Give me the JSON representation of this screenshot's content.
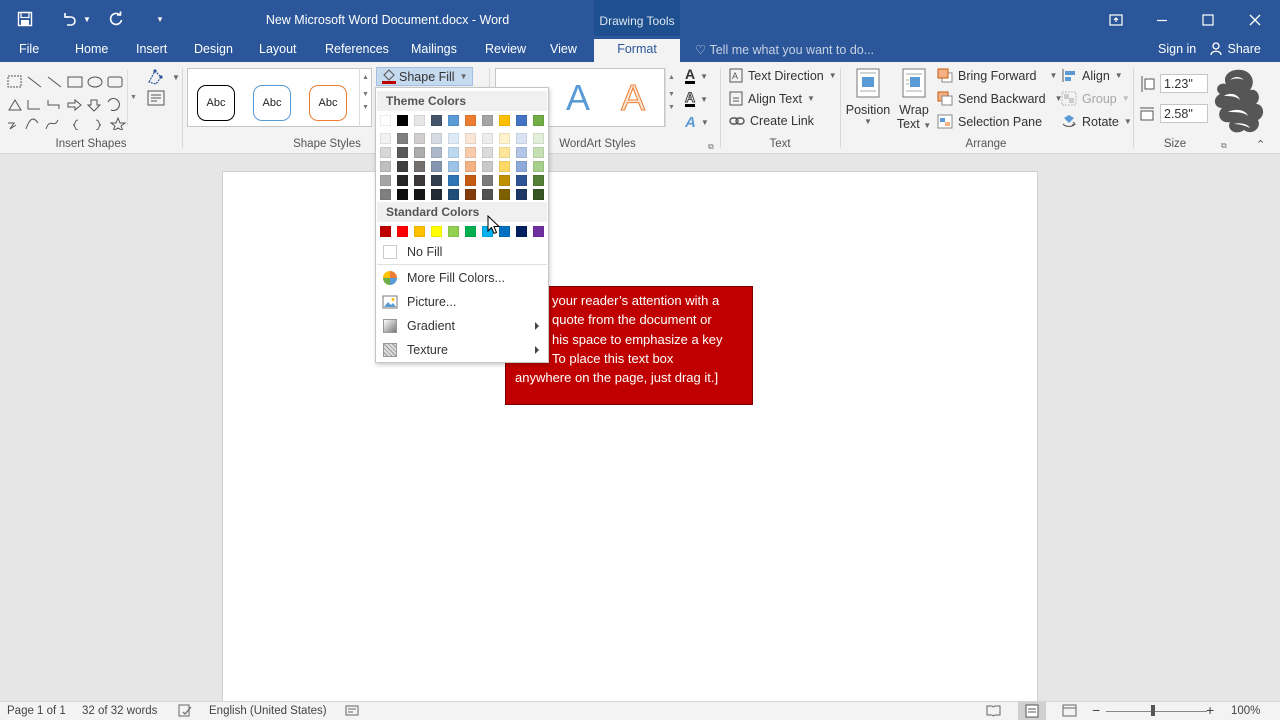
{
  "app": {
    "title": "New Microsoft Word Document.docx - Word",
    "context_tab_group": "Drawing Tools"
  },
  "tabs": [
    "File",
    "Home",
    "Insert",
    "Design",
    "Layout",
    "References",
    "Mailings",
    "Review",
    "View",
    "Format"
  ],
  "active_tab": "Format",
  "tell_me": "Tell me what you want to do...",
  "account": {
    "sign_in": "Sign in",
    "share": "Share"
  },
  "ribbon": {
    "groups": {
      "insert_shapes": "Insert Shapes",
      "shape_styles": "Shape Styles",
      "wordart_styles": "WordArt Styles",
      "text": "Text",
      "arrange": "Arrange",
      "size": "Size"
    },
    "shape_style_sample": "Abc",
    "shape_fill": "Shape Fill",
    "text_direction": "Text Direction",
    "align_text": "Align Text",
    "create_link": "Create Link",
    "position": "Position",
    "wrap_text_1": "Wrap",
    "wrap_text_2": "Text",
    "bring_forward": "Bring Forward",
    "send_backward": "Send Backward",
    "selection_pane": "Selection Pane",
    "align": "Align",
    "group": "Group",
    "rotate": "Rotate",
    "height": "1.23\"",
    "width": "2.58\"",
    "wordart_letter": "A"
  },
  "dropdown": {
    "theme_colors_label": "Theme Colors",
    "standard_colors_label": "Standard Colors",
    "theme_top_row": [
      "#ffffff",
      "#000000",
      "#e7e6e6",
      "#44546a",
      "#5b9bd5",
      "#ed7d31",
      "#a5a5a5",
      "#ffc000",
      "#4472c4",
      "#70ad47"
    ],
    "theme_shades": [
      [
        "#f2f2f2",
        "#7f7f7f",
        "#d0cece",
        "#d6dce4",
        "#deebf6",
        "#fbe5d5",
        "#ededed",
        "#fff2cc",
        "#dae3f3",
        "#e2efd9"
      ],
      [
        "#d8d8d8",
        "#595959",
        "#aeabab",
        "#adb9ca",
        "#bdd7ee",
        "#f7cbac",
        "#dbdbdb",
        "#fee599",
        "#b4c6e7",
        "#c5e0b3"
      ],
      [
        "#bfbfbf",
        "#3f3f3f",
        "#757070",
        "#8496b0",
        "#9dc3e6",
        "#f4b183",
        "#c9c9c9",
        "#ffd965",
        "#8eaadb",
        "#a8d08d"
      ],
      [
        "#a5a5a5",
        "#262626",
        "#3a3838",
        "#323f4f",
        "#2e75b5",
        "#c55a11",
        "#7b7b7b",
        "#bf9000",
        "#2f5496",
        "#538135"
      ],
      [
        "#7f7f7f",
        "#0c0c0c",
        "#171616",
        "#222a35",
        "#1e4e79",
        "#833c0b",
        "#525252",
        "#7f6000",
        "#1f3864",
        "#375623"
      ]
    ],
    "standard_colors": [
      "#c00000",
      "#ff0000",
      "#ffc000",
      "#ffff00",
      "#92d050",
      "#00b050",
      "#00b0f0",
      "#0070c0",
      "#002060",
      "#7030a0"
    ],
    "items": {
      "no_fill": "No Fill",
      "more_fill_colors": "More Fill Colors...",
      "picture": "Picture...",
      "gradient": "Gradient",
      "texture": "Texture"
    }
  },
  "document": {
    "textbox_lines": [
      "your reader’s attention with a",
      "quote from the document or",
      "his space to emphasize a key",
      "To place this text box",
      "anywhere on the page, just drag it.]"
    ],
    "textbox_fill": "#c00000"
  },
  "status": {
    "page": "Page 1 of 1",
    "words": "32 of 32 words",
    "language": "English (United States)",
    "zoom": "100%"
  },
  "colors": {
    "brand": "#2b579a",
    "ribbon_bg": "#f3f3f3",
    "canvas_bg": "#e6e6e6"
  }
}
